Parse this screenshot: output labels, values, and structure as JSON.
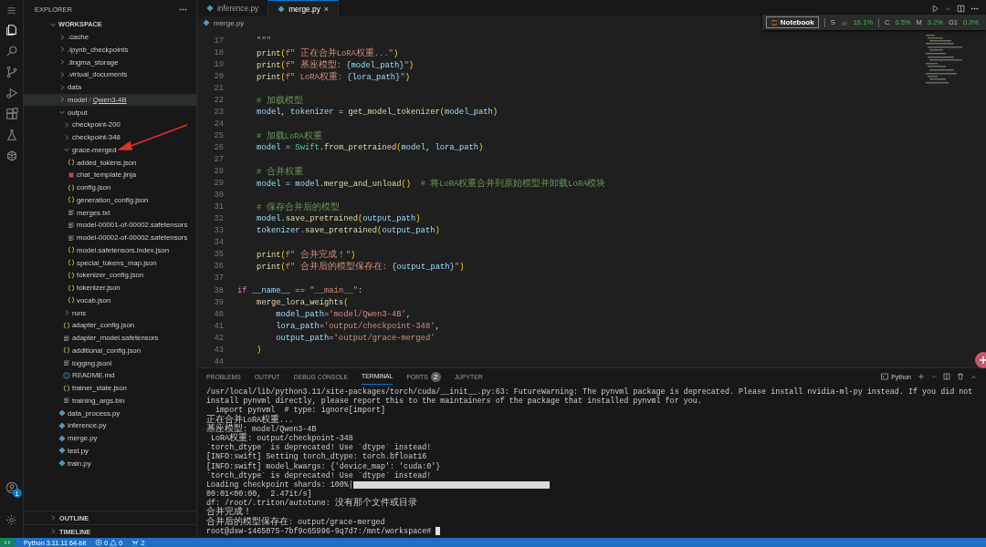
{
  "activity_bar": {
    "items": [
      {
        "selected": true
      },
      {
        "selected": false
      },
      {
        "selected": false
      },
      {
        "selected": false
      },
      {
        "selected": false
      },
      {
        "selected": false
      },
      {
        "selected": false
      }
    ],
    "account_badge": "1"
  },
  "explorer": {
    "title": "EXPLORER",
    "root": {
      "label": "WORKSPACE",
      "expanded": true,
      "children": [
        {
          "kind": "folder",
          "label": ".cache",
          "expanded": false,
          "selected": false
        },
        {
          "kind": "folder",
          "label": ".ipynb_checkpoints",
          "expanded": false,
          "selected": false
        },
        {
          "kind": "folder",
          "label": ".lingma_storage",
          "expanded": false,
          "selected": false
        },
        {
          "kind": "folder",
          "label": ".virtual_documents",
          "expanded": false,
          "selected": false
        },
        {
          "kind": "folder",
          "label": "data",
          "expanded": false,
          "selected": false
        },
        {
          "kind": "folder",
          "label": "model",
          "separator": "/",
          "compact": "Qwen3-4B",
          "expanded": false,
          "selected": true
        },
        {
          "kind": "folder",
          "label": "output",
          "expanded": true,
          "selected": false,
          "children": [
            {
              "kind": "folder",
              "label": "checkpoint-200",
              "expanded": false,
              "selected": false
            },
            {
              "kind": "folder",
              "label": "checkpoint-348",
              "expanded": false,
              "selected": false
            },
            {
              "kind": "folder",
              "label": "grace-merged",
              "expanded": true,
              "selected": false,
              "children": [
                {
                  "kind": "json",
                  "label": "added_tokens.json",
                  "selected": false
                },
                {
                  "kind": "jinja",
                  "label": "chat_template.jinja",
                  "selected": false
                },
                {
                  "kind": "json",
                  "label": "config.json",
                  "selected": false
                },
                {
                  "kind": "json",
                  "label": "generation_config.json",
                  "selected": false
                },
                {
                  "kind": "text",
                  "label": "merges.txt",
                  "selected": false
                },
                {
                  "kind": "text",
                  "label": "model-00001-of-00002.safetensors",
                  "selected": false
                },
                {
                  "kind": "text",
                  "label": "model-00002-of-00002.safetensors",
                  "selected": false
                },
                {
                  "kind": "json",
                  "label": "model.safetensors.index.json",
                  "selected": false
                },
                {
                  "kind": "json",
                  "label": "special_tokens_map.json",
                  "selected": false
                },
                {
                  "kind": "json",
                  "label": "tokenizer_config.json",
                  "selected": false
                },
                {
                  "kind": "json",
                  "label": "tokenizer.json",
                  "selected": false
                },
                {
                  "kind": "json",
                  "label": "vocab.json",
                  "selected": false
                }
              ]
            },
            {
              "kind": "folder",
              "label": "runs",
              "expanded": false,
              "selected": false
            },
            {
              "kind": "json",
              "label": "adapter_config.json",
              "selected": false
            },
            {
              "kind": "text",
              "label": "adapter_model.safetensors",
              "selected": false
            },
            {
              "kind": "json",
              "label": "additional_config.json",
              "selected": false
            },
            {
              "kind": "text",
              "label": "logging.jsonl",
              "selected": false
            },
            {
              "kind": "info",
              "label": "README.md",
              "selected": false
            },
            {
              "kind": "json",
              "label": "trainer_state.json",
              "selected": false
            },
            {
              "kind": "text",
              "label": "training_args.bin",
              "selected": false
            }
          ]
        },
        {
          "kind": "python",
          "label": "data_process.py",
          "selected": false
        },
        {
          "kind": "python",
          "label": "inference.py",
          "selected": false
        },
        {
          "kind": "python",
          "label": "merge.py",
          "selected": false
        },
        {
          "kind": "python",
          "label": "test.py",
          "selected": false
        },
        {
          "kind": "python",
          "label": "train.py",
          "selected": false
        }
      ]
    },
    "sections": [
      {
        "label": "OUTLINE",
        "expanded": false
      },
      {
        "label": "TIMELINE",
        "expanded": false
      }
    ]
  },
  "editor": {
    "tabs": [
      {
        "label": "inference.py",
        "selected": false
      },
      {
        "label": "merge.py",
        "selected": true,
        "close": "×"
      }
    ],
    "breadcrumb": "merge.py",
    "notebook_bar": {
      "button": "Notebook",
      "s_label": "S",
      "s_value": "16.1%",
      "c_label": "C",
      "c_value": "0.5%",
      "m_label": "M",
      "m_value": "3.2%",
      "g_label": "G1",
      "g_value": "0.0%"
    },
    "lines": [
      {
        "number": "17",
        "tokens": [
          {
            "kind": "str",
            "text": "    \"\"\""
          }
        ]
      },
      {
        "number": "18",
        "tokens": [
          {
            "kind": "fn",
            "text": "    print"
          },
          {
            "kind": "br",
            "text": "("
          },
          {
            "kind": "str",
            "text": "f\" 正在合并LoRA权重...\""
          },
          {
            "kind": "br",
            "text": ")"
          }
        ]
      },
      {
        "number": "19",
        "tokens": [
          {
            "kind": "fn",
            "text": "    print"
          },
          {
            "kind": "br",
            "text": "("
          },
          {
            "kind": "str",
            "text": "f\" 基座模型: "
          },
          {
            "kind": "var",
            "text": "{model_path}"
          },
          {
            "kind": "str",
            "text": "\""
          },
          {
            "kind": "br",
            "text": ")"
          }
        ]
      },
      {
        "number": "20",
        "tokens": [
          {
            "kind": "fn",
            "text": "    print"
          },
          {
            "kind": "br",
            "text": "("
          },
          {
            "kind": "str",
            "text": "f\" LoRA权重: "
          },
          {
            "kind": "var",
            "text": "{lora_path}"
          },
          {
            "kind": "str",
            "text": "\""
          },
          {
            "kind": "br",
            "text": ")"
          }
        ]
      },
      {
        "number": "21"
      },
      {
        "number": "22",
        "tokens": [
          {
            "kind": "cm",
            "text": "    # 加载模型"
          }
        ]
      },
      {
        "number": "23",
        "tokens": [
          {
            "kind": "var",
            "text": "    model"
          },
          {
            "kind": "def",
            "text": ", "
          },
          {
            "kind": "var",
            "text": "tokenizer"
          },
          {
            "kind": "def",
            "text": " = "
          },
          {
            "kind": "fn",
            "text": "get_model_tokenizer"
          },
          {
            "kind": "br",
            "text": "("
          },
          {
            "kind": "var",
            "text": "model_path"
          },
          {
            "kind": "br",
            "text": ")"
          }
        ]
      },
      {
        "number": "24"
      },
      {
        "number": "25",
        "tokens": [
          {
            "kind": "cm",
            "text": "    # 加载LoRA权重"
          }
        ]
      },
      {
        "number": "26",
        "tokens": [
          {
            "kind": "var",
            "text": "    model"
          },
          {
            "kind": "def",
            "text": " = "
          },
          {
            "kind": "cls",
            "text": "Swift"
          },
          {
            "kind": "def",
            "text": "."
          },
          {
            "kind": "fn",
            "text": "from_pretrained"
          },
          {
            "kind": "br",
            "text": "("
          },
          {
            "kind": "var",
            "text": "model"
          },
          {
            "kind": "def",
            "text": ", "
          },
          {
            "kind": "var",
            "text": "lora_path"
          },
          {
            "kind": "br",
            "text": ")"
          }
        ]
      },
      {
        "number": "27"
      },
      {
        "number": "28",
        "tokens": [
          {
            "kind": "cm",
            "text": "    # 合并权重"
          }
        ]
      },
      {
        "number": "29",
        "tokens": [
          {
            "kind": "var",
            "text": "    model"
          },
          {
            "kind": "def",
            "text": " = "
          },
          {
            "kind": "var",
            "text": "model"
          },
          {
            "kind": "def",
            "text": "."
          },
          {
            "kind": "fn",
            "text": "merge_and_unload"
          },
          {
            "kind": "br",
            "text": "()"
          },
          {
            "kind": "cm",
            "text": "  # 将LoRA权重合并到原始模型并卸载LoRA模块"
          }
        ]
      },
      {
        "number": "30"
      },
      {
        "number": "31",
        "tokens": [
          {
            "kind": "cm",
            "text": "    # 保存合并后的模型"
          }
        ]
      },
      {
        "number": "32",
        "tokens": [
          {
            "kind": "var",
            "text": "    model"
          },
          {
            "kind": "def",
            "text": "."
          },
          {
            "kind": "fn",
            "text": "save_pretrained"
          },
          {
            "kind": "br",
            "text": "("
          },
          {
            "kind": "var",
            "text": "output_path"
          },
          {
            "kind": "br",
            "text": ")"
          }
        ]
      },
      {
        "number": "33",
        "tokens": [
          {
            "kind": "var",
            "text": "    tokenizer"
          },
          {
            "kind": "def",
            "text": "."
          },
          {
            "kind": "fn",
            "text": "save_pretrained"
          },
          {
            "kind": "br",
            "text": "("
          },
          {
            "kind": "var",
            "text": "output_path"
          },
          {
            "kind": "br",
            "text": ")"
          }
        ]
      },
      {
        "number": "34"
      },
      {
        "number": "35",
        "tokens": [
          {
            "kind": "fn",
            "text": "    print"
          },
          {
            "kind": "br",
            "text": "("
          },
          {
            "kind": "str",
            "text": "f\" 合并完成！\""
          },
          {
            "kind": "br",
            "text": ")"
          }
        ]
      },
      {
        "number": "36",
        "tokens": [
          {
            "kind": "fn",
            "text": "    print"
          },
          {
            "kind": "br",
            "text": "("
          },
          {
            "kind": "str",
            "text": "f\" 合并后的模型保存在: "
          },
          {
            "kind": "var",
            "text": "{output_path}"
          },
          {
            "kind": "str",
            "text": "\""
          },
          {
            "kind": "br",
            "text": ")"
          }
        ]
      },
      {
        "number": "37"
      },
      {
        "number": "38",
        "tokens": [
          {
            "kind": "kw",
            "text": "if"
          },
          {
            "kind": "var",
            "text": " __name__"
          },
          {
            "kind": "def",
            "text": " == "
          },
          {
            "kind": "str",
            "text": "\"__main__\""
          },
          {
            "kind": "def",
            "text": ":"
          }
        ]
      },
      {
        "number": "39",
        "tokens": [
          {
            "kind": "fn",
            "text": "    merge_lora_weights"
          },
          {
            "kind": "br",
            "text": "("
          }
        ]
      },
      {
        "number": "40",
        "tokens": [
          {
            "kind": "var",
            "text": "        model_path"
          },
          {
            "kind": "def",
            "text": "="
          },
          {
            "kind": "str",
            "text": "'model/Qwen3-4B'"
          },
          {
            "kind": "def",
            "text": ","
          }
        ]
      },
      {
        "number": "41",
        "tokens": [
          {
            "kind": "var",
            "text": "        lora_path"
          },
          {
            "kind": "def",
            "text": "="
          },
          {
            "kind": "str",
            "text": "'output/checkpoint-348'"
          },
          {
            "kind": "def",
            "text": ","
          }
        ]
      },
      {
        "number": "42",
        "tokens": [
          {
            "kind": "var",
            "text": "        output_path"
          },
          {
            "kind": "def",
            "text": "="
          },
          {
            "kind": "str",
            "text": "'output/grace-merged'"
          }
        ]
      },
      {
        "number": "43",
        "tokens": [
          {
            "kind": "br",
            "text": "    )"
          }
        ]
      },
      {
        "number": "44"
      }
    ]
  },
  "panel": {
    "tabs": [
      {
        "label": "PROBLEMS",
        "selected": false
      },
      {
        "label": "OUTPUT",
        "selected": false
      },
      {
        "label": "DEBUG CONSOLE",
        "selected": false
      },
      {
        "label": "TERMINAL",
        "selected": true
      },
      {
        "label": "PORTS",
        "selected": false,
        "badge": "2"
      },
      {
        "label": "JUPYTER",
        "selected": false
      }
    ],
    "terminal_profile": "Python",
    "terminal_lines": [
      {
        "kind": "text",
        "text": "/usr/local/lib/python3.11/site-packages/torch/cuda/__init__.py:63: FutureWarning: The pynvml package is deprecated. Please install nvidia-ml-py instead. If you did not"
      },
      {
        "kind": "text",
        "text": "install pynvml directly, please report this to the maintainers of the package that installed pynvml for you."
      },
      {
        "kind": "text",
        "text": "  import pynvml  # type: ignore[import]"
      },
      {
        "kind": "text",
        "text": " 正在合并LoRA权重..."
      },
      {
        "kind": "text",
        "text": " 基座模型: model/Qwen3-4B"
      },
      {
        "kind": "text",
        "text": " LoRA权重: output/checkpoint-348"
      },
      {
        "kind": "text",
        "text": "`torch_dtype` is deprecated! Use `dtype` instead!"
      },
      {
        "kind": "text",
        "text": "[INFO:swift] Setting torch_dtype: torch.bfloat16"
      },
      {
        "kind": "text",
        "text": "[INFO:swift] model_kwargs: {'device_map': 'cuda:0'}"
      },
      {
        "kind": "text",
        "text": "`torch_dtype` is deprecated! Use `dtype` instead!"
      },
      {
        "kind": "progress",
        "text": "Loading checkpoint shards: 100%|",
        "level": 1
      },
      {
        "kind": "text",
        "text": "00:01<00:00,  2.47it/s]"
      },
      {
        "kind": "text",
        "text": "df: /root/.triton/autotune: 没有那个文件或目录"
      },
      {
        "kind": "text",
        "text": " 合并完成！"
      },
      {
        "kind": "text",
        "text": " 合并后的模型保存在: output/grace-merged"
      },
      {
        "kind": "prompt",
        "text": "root@dsw-1465075-7bf9c65996-9q7d7:/mnt/workspace#"
      }
    ]
  },
  "status_bar": {
    "interpreter": "Python 3.11.11 64-bit",
    "errors": "0",
    "warnings": "0",
    "ports": "2"
  }
}
